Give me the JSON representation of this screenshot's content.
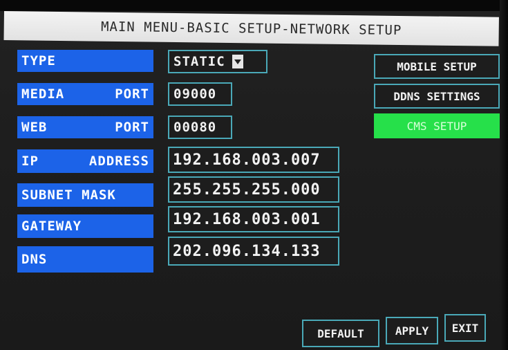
{
  "title": "MAIN MENU-BASIC SETUP-NETWORK SETUP",
  "fields": {
    "type": {
      "label": "TYPE",
      "value": "STATIC"
    },
    "media_port": {
      "label_a": "MEDIA",
      "label_b": "PORT",
      "value": "09000"
    },
    "web_port": {
      "label_a": "WEB",
      "label_b": "PORT",
      "value": "00080"
    },
    "ip_address": {
      "label_a": "IP",
      "label_b": "ADDRESS",
      "value": "192.168.003.007"
    },
    "subnet_mask": {
      "label": "SUBNET MASK",
      "value": "255.255.255.000"
    },
    "gateway": {
      "label": "GATEWAY",
      "value": "192.168.003.001"
    },
    "dns": {
      "label": "DNS",
      "value": "202.096.134.133"
    }
  },
  "side_buttons": {
    "mobile_setup": "MOBILE SETUP",
    "ddns_settings": "DDNS SETTINGS",
    "cms_setup": "CMS SETUP"
  },
  "bottom_buttons": {
    "default": "DEFAULT",
    "apply": "APPLY",
    "exit": "EXIT"
  },
  "colors": {
    "label_bg": "#1c63e8",
    "field_border": "#4aa9b8",
    "active_button": "#26e04a",
    "title_bg": "#efefef"
  }
}
